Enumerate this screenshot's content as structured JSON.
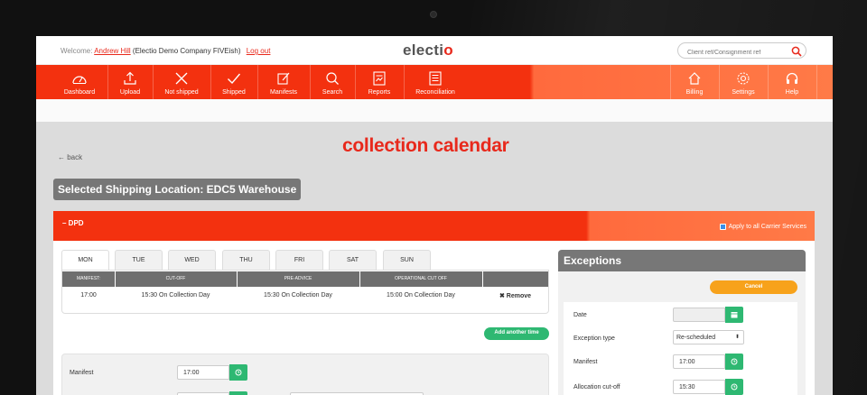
{
  "topbar": {
    "welcome_prefix": "Welcome:",
    "user_name": "Andrew Hill",
    "company": "(Electio Demo Company FIVEish)",
    "logout": "Log out",
    "logo_main": "electi",
    "logo_accent": "o",
    "search_placeholder": "Client ref/Consignment ref"
  },
  "nav": {
    "left_items": [
      {
        "label": "Dashboard",
        "icon": "gauge-icon"
      },
      {
        "label": "Upload",
        "icon": "upload-icon"
      },
      {
        "label": "Not shipped",
        "icon": "x-icon"
      },
      {
        "label": "Shipped",
        "icon": "check-icon"
      },
      {
        "label": "Manifests",
        "icon": "edit-icon"
      },
      {
        "label": "Search",
        "icon": "search-icon"
      },
      {
        "label": "Reports",
        "icon": "report-icon"
      },
      {
        "label": "Reconciliation",
        "icon": "ledger-icon"
      }
    ],
    "right_items": [
      {
        "label": "Billing",
        "icon": "home-icon"
      },
      {
        "label": "Settings",
        "icon": "gear-icon"
      },
      {
        "label": "Help",
        "icon": "headset-icon"
      }
    ]
  },
  "page": {
    "back": "← back",
    "title": "collection calendar",
    "location": "Selected Shipping Location: EDC5 Warehouse"
  },
  "carrier": {
    "name": "– DPD",
    "apply_all": "Apply to all Carrier Services",
    "apply_all_checked": true
  },
  "days": [
    "MON",
    "TUE",
    "WED",
    "THU",
    "FRI",
    "SAT",
    "SUN"
  ],
  "active_day": "MON",
  "schedule": {
    "headers": [
      "MANIFEST:",
      "CUT-OFF",
      "PRE-ADVICE",
      "OPERATIONAL CUT OFF"
    ],
    "row": {
      "manifest": "17:00",
      "cutoff": "15:30 On Collection Day",
      "preadvice": "15:30 On Collection Day",
      "operational": "15:00 On Collection Day",
      "remove": "✖ Remove"
    }
  },
  "add_time": "Add another time",
  "form": {
    "manifest_label": "Manifest",
    "manifest_value": "17:00"
  },
  "exceptions": {
    "title": "Exceptions",
    "cancel": "Cancel",
    "date_label": "Date",
    "type_label": "Exception type",
    "type_value": "Re-scheduled",
    "manifest_label": "Manifest",
    "manifest_value": "17:00",
    "cutoff_label": "Allocation cut-off",
    "cutoff_value": "15:30"
  },
  "colors": {
    "brand_red": "#f3310f",
    "brand_orange": "#ff7a47",
    "green": "#2eb872",
    "amber": "#f7a21b",
    "grey": "#777777"
  }
}
